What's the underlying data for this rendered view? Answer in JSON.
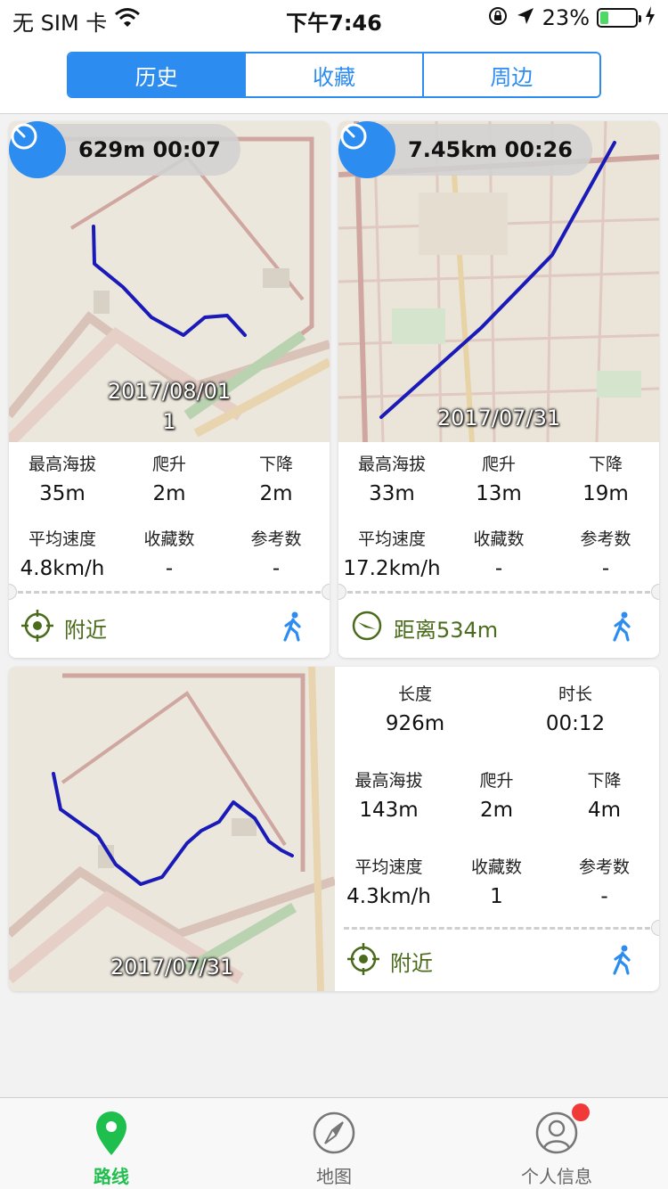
{
  "status_bar": {
    "carrier": "无 SIM 卡",
    "time": "下午7:46",
    "battery_percent": "23%",
    "battery_level": 0.23
  },
  "segments": [
    {
      "label": "历史",
      "active": true
    },
    {
      "label": "收藏",
      "active": false
    },
    {
      "label": "周边",
      "active": false
    }
  ],
  "cards": [
    {
      "badge": "629m 00:07",
      "date": "2017/08/01",
      "date_line2": "1",
      "stats": [
        {
          "label": "最高海拔",
          "value": "35m"
        },
        {
          "label": "爬升",
          "value": "2m"
        },
        {
          "label": "下降",
          "value": "2m"
        },
        {
          "label": "平均速度",
          "value": "4.8km/h"
        },
        {
          "label": "收藏数",
          "value": "-"
        },
        {
          "label": "参考数",
          "value": "-"
        }
      ],
      "footer_text": "附近",
      "footer_icon": "crosshair-icon"
    },
    {
      "badge": "7.45km 00:26",
      "date": "2017/07/31",
      "stats": [
        {
          "label": "最高海拔",
          "value": "33m"
        },
        {
          "label": "爬升",
          "value": "13m"
        },
        {
          "label": "下降",
          "value": "19m"
        },
        {
          "label": "平均速度",
          "value": "17.2km/h"
        },
        {
          "label": "收藏数",
          "value": "-"
        },
        {
          "label": "参考数",
          "value": "-"
        }
      ],
      "footer_text": "距离534m",
      "footer_icon": "direction-arrow-icon"
    },
    {
      "date": "2017/07/31",
      "summary": [
        {
          "label": "长度",
          "value": "926m"
        },
        {
          "label": "时长",
          "value": "00:12"
        }
      ],
      "stats": [
        {
          "label": "最高海拔",
          "value": "143m"
        },
        {
          "label": "爬升",
          "value": "2m"
        },
        {
          "label": "下降",
          "value": "4m"
        },
        {
          "label": "平均速度",
          "value": "4.3km/h"
        },
        {
          "label": "收藏数",
          "value": "1"
        },
        {
          "label": "参考数",
          "value": "-"
        }
      ],
      "footer_text": "附近",
      "footer_icon": "crosshair-icon"
    }
  ],
  "tabs": [
    {
      "label": "路线",
      "icon": "map-pin-icon",
      "active": true
    },
    {
      "label": "地图",
      "icon": "compass-icon",
      "active": false
    },
    {
      "label": "个人信息",
      "icon": "profile-icon",
      "active": false,
      "badge": true
    }
  ],
  "colors": {
    "accent": "#2d8cf0",
    "active_tab": "#1fbf4e",
    "route": "#1a1ab8",
    "footer_text": "#4b6b1c",
    "badge": "#f03a3a"
  }
}
